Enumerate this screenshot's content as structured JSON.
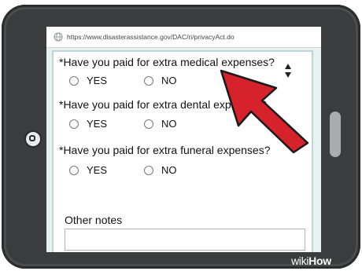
{
  "browser": {
    "url": "https://www.disasterassistance.gov/DAC/ri/privacyAct.do",
    "icon": "globe-icon"
  },
  "form": {
    "questions": [
      {
        "label": "*Have you paid for extra medical expenses?",
        "yes": "YES",
        "no": "NO"
      },
      {
        "label": "*Have you paid for extra dental expenses?",
        "yes": "YES",
        "no": "NO"
      },
      {
        "label": "*Have you paid for extra funeral expenses?",
        "yes": "YES",
        "no": "NO"
      }
    ],
    "notes_label": "Other notes",
    "notes_value": ""
  },
  "scroll_icon": "sort-arrows-icon",
  "pointer_icon": "arrow-cursor-icon",
  "watermark": {
    "part1": "wiki",
    "part2": "How"
  },
  "colors": {
    "cursor": "#d6232b",
    "device": "#3a3c3d",
    "screen_bg": "#e8f1f2"
  }
}
